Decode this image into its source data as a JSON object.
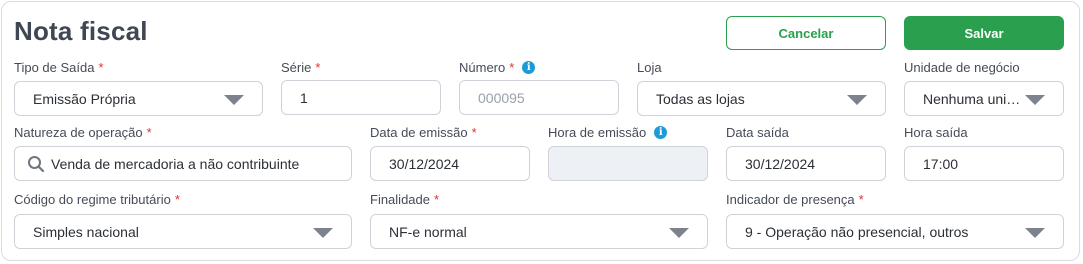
{
  "header": {
    "title": "Nota fiscal",
    "cancel_label": "Cancelar",
    "save_label": "Salvar"
  },
  "fields": {
    "tipo_saida": {
      "label": "Tipo de Saída",
      "required": "*",
      "value": "Emissão Própria"
    },
    "serie": {
      "label": "Série",
      "required": "*",
      "value": "1"
    },
    "numero": {
      "label": "Número",
      "required": "*",
      "placeholder": "000095",
      "info_glyph": "i"
    },
    "loja": {
      "label": "Loja",
      "value": "Todas as lojas"
    },
    "unidade_negocio": {
      "label": "Unidade de negócio",
      "value": "Nenhuma uni…"
    },
    "natureza_operacao": {
      "label": "Natureza de operação",
      "required": "*",
      "value": "Venda de mercadoria a não contribuinte"
    },
    "data_emissao": {
      "label": "Data de emissão",
      "required": "*",
      "value": "30/12/2024"
    },
    "hora_emissao": {
      "label": "Hora de emissão",
      "info_glyph": "i",
      "value": ""
    },
    "data_saida": {
      "label": "Data saída",
      "value": "30/12/2024"
    },
    "hora_saida": {
      "label": "Hora saída",
      "value": "17:00"
    },
    "regime_tributario": {
      "label": "Código do regime tributário",
      "required": "*",
      "value": "Simples nacional"
    },
    "finalidade": {
      "label": "Finalidade",
      "required": "*",
      "value": "NF-e normal"
    },
    "indicador_presenca": {
      "label": "Indicador de presença",
      "required": "*",
      "value": "9 - Operação não presencial, outros"
    }
  },
  "colors": {
    "accent_green": "#2aa04e",
    "required_red": "#e0322f",
    "info_blue": "#1d9bd8",
    "disabled_bg": "#edf1f5"
  }
}
